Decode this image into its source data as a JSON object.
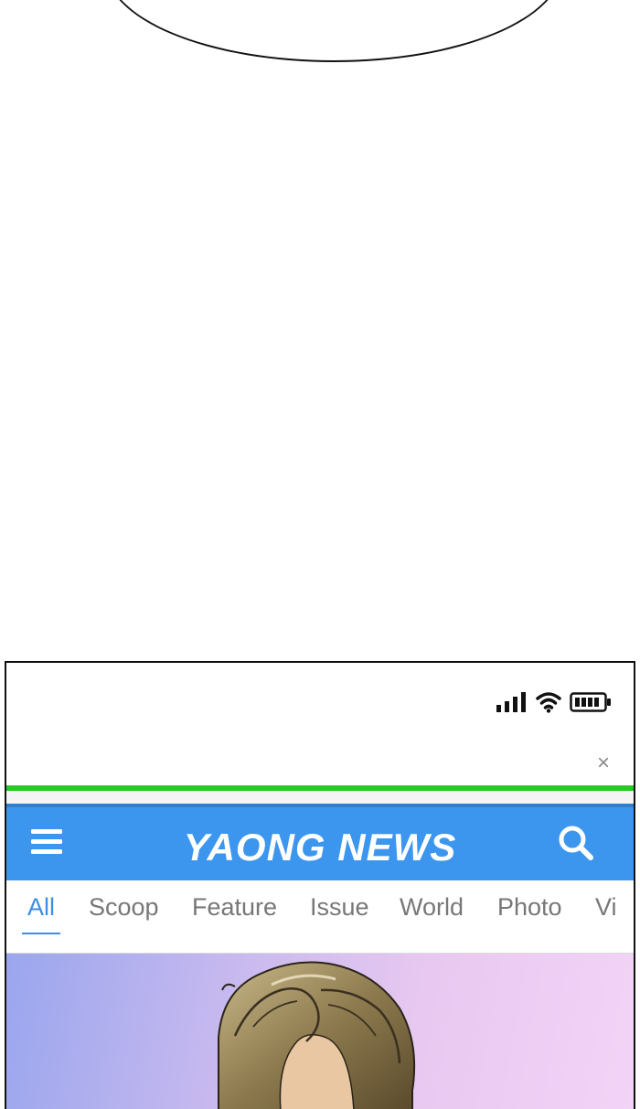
{
  "status_bar": {
    "signal_icon": "signal-bars-icon",
    "wifi_icon": "wifi-icon",
    "battery_icon": "battery-icon"
  },
  "browser": {
    "close_label": "×",
    "load_progress": 1.0,
    "progress_color": "#22cc22"
  },
  "app": {
    "title": "YAONG NEWS",
    "header_color": "#3d96ee",
    "menu_icon": "hamburger-menu-icon",
    "search_icon": "search-icon"
  },
  "tabs": [
    {
      "label": "All",
      "active": true
    },
    {
      "label": "Scoop",
      "active": false
    },
    {
      "label": "Feature",
      "active": false
    },
    {
      "label": "Issue",
      "active": false
    },
    {
      "label": "World",
      "active": false
    },
    {
      "label": "Photo",
      "active": false
    },
    {
      "label": "Vi",
      "active": false
    }
  ],
  "accent_color": "#3d8ee6"
}
